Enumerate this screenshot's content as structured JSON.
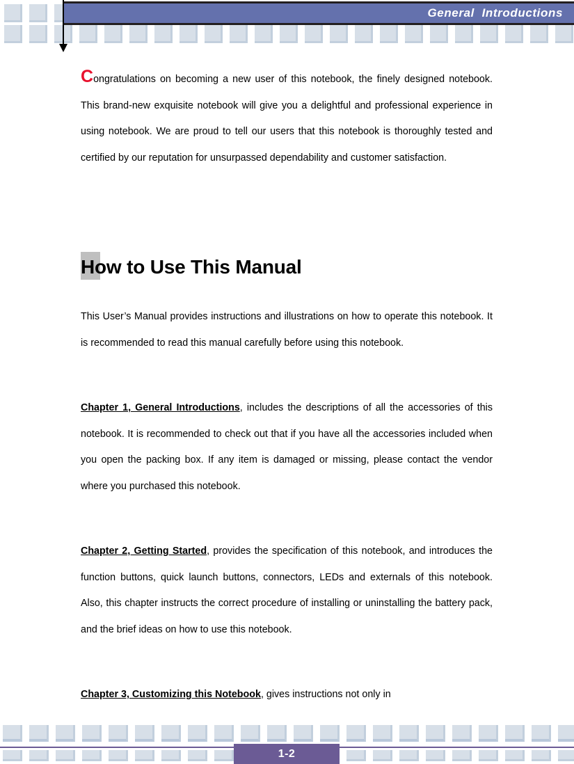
{
  "header": {
    "title": "General  Introductions",
    "banner_color": "#6471AD",
    "tile_color": "#D7DFE8",
    "tile_count_top": 3,
    "tile_count_bottom": 23
  },
  "document": {
    "intro": {
      "dropcap": "C",
      "text": "ongratulations on becoming a new user of this notebook, the finely designed notebook.   This brand-new exquisite notebook will give you a delightful and professional experience in using notebook.    We are proud to tell our users that this notebook is thoroughly tested and certified by our reputation for unsurpassed dependability and customer satisfaction."
    },
    "section_heading": {
      "initial": "H",
      "rest": "ow to Use This Manual",
      "highlight_color": "#BFBFBF"
    },
    "paragraphs": [
      {
        "id": "manual-overview",
        "lead_in": "",
        "text": "This User’s Manual provides instructions and illustrations on how to operate this notebook.   It is recommended to read this manual carefully before using this notebook."
      },
      {
        "id": "chapter-1",
        "lead_in": "Chapter 1, General Introductions",
        "text": ", includes the descriptions of all the accessories of this notebook.   It is recommended to check out that if you have all the accessories included when you open the packing box.   If any item is damaged or missing, please contact the vendor where you purchased this notebook."
      },
      {
        "id": "chapter-2",
        "lead_in": "Chapter 2, Getting Started",
        "text": ", provides the specification of this notebook, and introduces the function buttons, quick launch buttons, connectors, LEDs and externals of this notebook.   Also, this chapter instructs the correct procedure of installing or uninstalling the battery pack, and the brief ideas on how to use this notebook."
      },
      {
        "id": "chapter-3",
        "lead_in": "Chapter 3, Customizing this Notebook",
        "text": ", gives instructions not only in"
      }
    ]
  },
  "footer": {
    "page_number": "1-2",
    "badge_color": "#6B5B95",
    "rule_color": "#6B5B95",
    "tile_color": "#D7DFE8",
    "tile_count": 23
  }
}
